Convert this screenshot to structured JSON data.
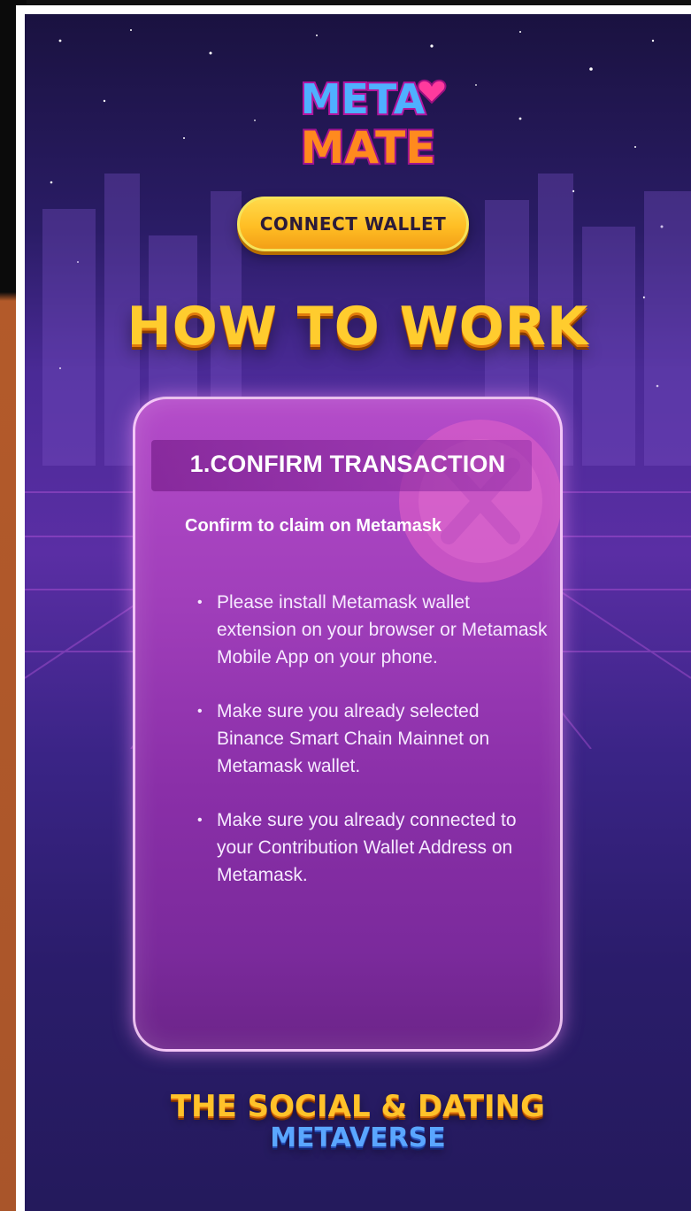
{
  "header": {
    "logo_line1": "META",
    "logo_line2": "MATE",
    "connect_button": "CONNECT WALLET"
  },
  "main": {
    "heading": "HOW TO WORK",
    "card": {
      "title": "1.CONFIRM TRANSACTION",
      "subtitle": "Confirm to claim on Metamask",
      "bullets": [
        "Please install Metamask wallet extension on your browser or Metamask Mobile App on your phone.",
        "Make sure you already selected Binance Smart Chain Mainnet on Metamask wallet.",
        "Make sure you already connected to your Contribution Wallet Address on Metamask."
      ]
    }
  },
  "footer": {
    "tagline_line1": "THE SOCIAL & DATING",
    "tagline_line2": "METAVERSE"
  },
  "colors": {
    "accent_yellow": "#ffcc2e",
    "accent_blue": "#5aa6ff",
    "card_purple": "#a13fbb",
    "bg_purple": "#4a2a96"
  }
}
